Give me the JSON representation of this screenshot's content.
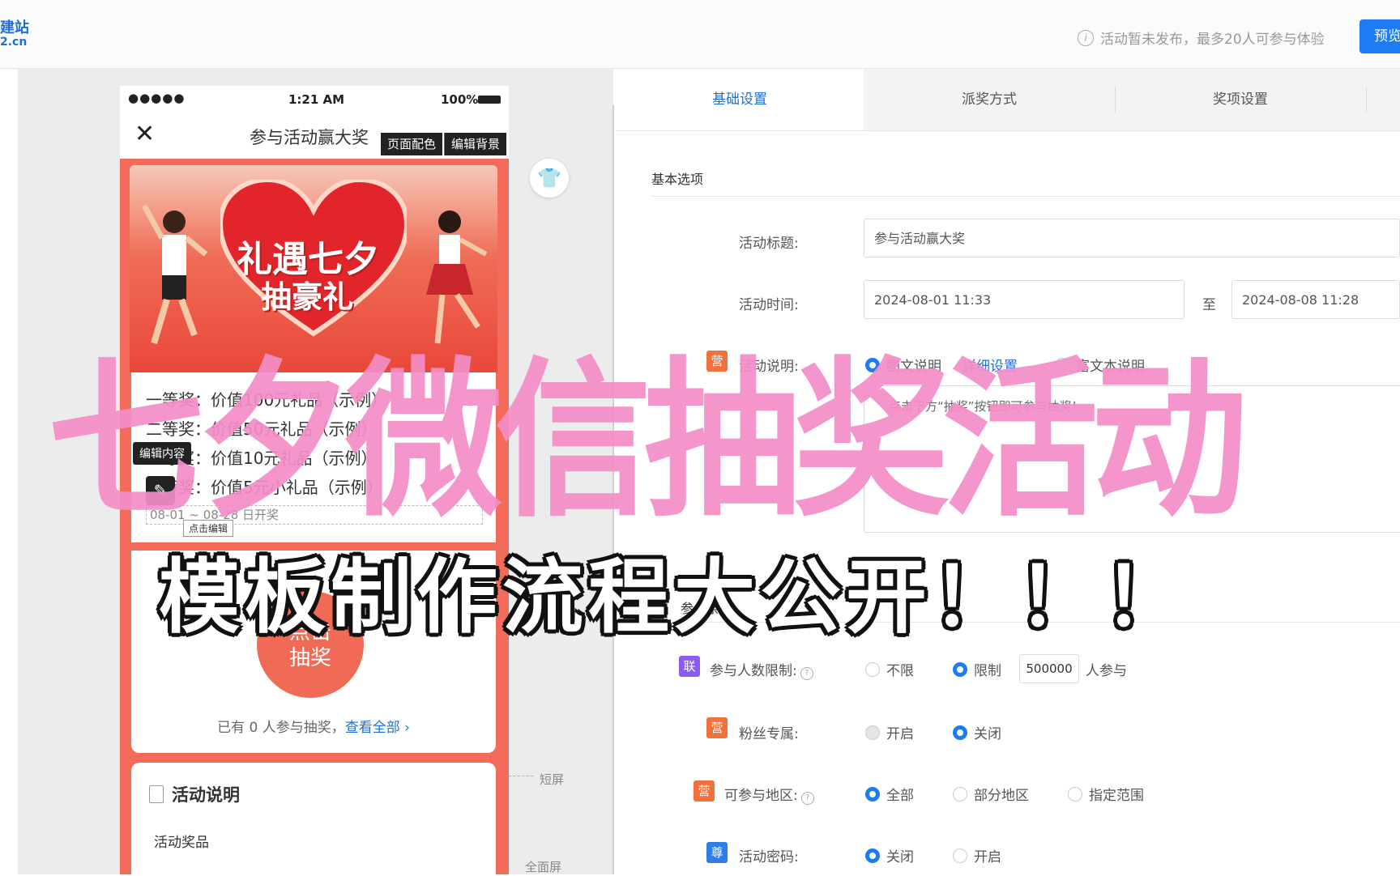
{
  "header": {
    "logo_line1": "建站",
    "logo_line2": "2.cn",
    "notice": "活动暂未发布，最多20人可参与体验",
    "preview_button": "预览"
  },
  "phone": {
    "signal": "●●●●●",
    "time": "1:21 AM",
    "battery": "100%",
    "title": "参与活动赢大奖",
    "tag_color": "页面配色",
    "tag_background": "编辑背景",
    "banner_line1": "礼遇七夕",
    "banner_line2": "抽豪礼",
    "prizes": [
      "一等奖：价值100元礼品（示例）",
      "二等奖：价值50元礼品（示例）",
      "三等奖：价值10元礼品（示例）",
      "四等奖：价值5元小礼品（示例）"
    ],
    "prize_date": "08-01 ~ 08-28 日开奖",
    "edit_tooltip": "编辑内容",
    "click_edit": "点击编辑",
    "lottery_button_line1": "点击",
    "lottery_button_line2": "抽奖",
    "participants_text": "已有 0 人参与抽奖，",
    "view_all": "查看全部 ›",
    "desc_title": "活动说明",
    "desc_sub": "活动奖品",
    "short_screen": "短屏",
    "full_screen": "全面屏"
  },
  "tabs": [
    "基础设置",
    "派奖方式",
    "奖项设置"
  ],
  "settings": {
    "section_basic": "基本选项",
    "title_label": "活动标题:",
    "title_value": "参与活动赢大奖",
    "time_label": "活动时间:",
    "time_start": "2024-08-01 11:33",
    "time_sep": "至",
    "time_end": "2024-08-08 11:28",
    "desc_label": "活动说明:",
    "desc_opt1": "图文说明",
    "desc_detail_link": "详细设置",
    "desc_opt2": "富文本说明",
    "desc_box_text": "点击下方“抽奖”按钮即可参与抽奖！",
    "section_condition": "参与条件",
    "limit_label": "参与人数限制:",
    "limit_opt1": "不限",
    "limit_opt2": "限制",
    "limit_value": "500000",
    "limit_suffix": "人参与",
    "fans_label": "粉丝专属:",
    "fans_opt1": "开启",
    "fans_opt2": "关闭",
    "region_label": "可参与地区:",
    "region_opt1": "全部",
    "region_opt2": "部分地区",
    "region_opt3": "指定范围",
    "pwd_label": "活动密码:",
    "pwd_opt1": "关闭",
    "pwd_opt2": "开启",
    "badges": {
      "ying": "营",
      "lian": "联",
      "zun": "尊"
    }
  },
  "overlay": {
    "big_title": "七夕微信抽奖活动",
    "sub_title": "模板制作流程大公开！！！"
  },
  "colors": {
    "accent_blue": "#1e7cf2",
    "phone_red": "#f26b5b",
    "badge_orange": "#f2703c",
    "badge_purple": "#8a5cf0",
    "badge_blue": "#2f7de8",
    "overlay_pink": "#f48ec7"
  }
}
